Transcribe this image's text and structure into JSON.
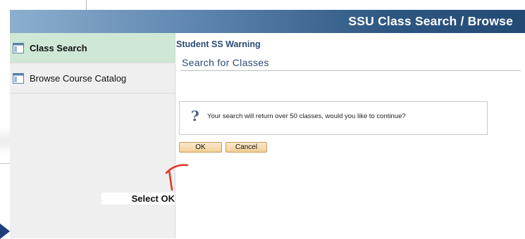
{
  "header": {
    "title": "SSU Class Search / Browse"
  },
  "sidebar": {
    "items": [
      {
        "label": "Class Search",
        "icon": "window-icon",
        "active": true
      },
      {
        "label": "Browse Course Catalog",
        "icon": "window-icon",
        "active": false
      }
    ]
  },
  "main": {
    "page_title": "Student SS Warning",
    "section_heading": "Search for Classes",
    "message": {
      "icon": "question-icon",
      "text": "Your search will return over 50 classes, would you like to continue?"
    },
    "buttons": {
      "ok": "OK",
      "cancel": "Cancel"
    }
  },
  "annotation": {
    "label": "Select OK",
    "arrow_color": "#e8372a"
  },
  "colors": {
    "header_dark": "#234a74",
    "active_item": "#cfe8d6",
    "heading_blue": "#2b4a73",
    "button_fill": "#f3cf98"
  }
}
